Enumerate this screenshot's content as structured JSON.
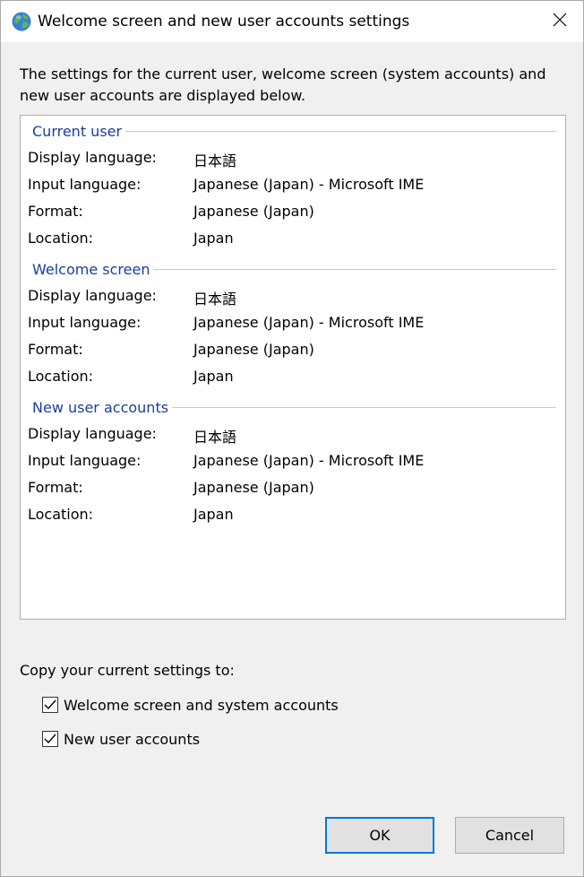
{
  "window": {
    "title": "Welcome screen and new user accounts settings",
    "icon": "globe-icon",
    "close_icon": "close-icon"
  },
  "intro_text": "The settings for the current user, welcome screen (system accounts) and new user accounts are displayed below.",
  "sections": [
    {
      "title": "Current user",
      "rows": [
        {
          "label": "Display language:",
          "value": "日本語"
        },
        {
          "label": "Input language:",
          "value": "Japanese (Japan) - Microsoft IME"
        },
        {
          "label": "Format:",
          "value": "Japanese (Japan)"
        },
        {
          "label": "Location:",
          "value": "Japan"
        }
      ]
    },
    {
      "title": "Welcome screen",
      "rows": [
        {
          "label": "Display language:",
          "value": "日本語"
        },
        {
          "label": "Input language:",
          "value": "Japanese (Japan) - Microsoft IME"
        },
        {
          "label": "Format:",
          "value": "Japanese (Japan)"
        },
        {
          "label": "Location:",
          "value": "Japan"
        }
      ]
    },
    {
      "title": "New user accounts",
      "rows": [
        {
          "label": "Display language:",
          "value": "日本語"
        },
        {
          "label": "Input language:",
          "value": "Japanese (Japan) - Microsoft IME"
        },
        {
          "label": "Format:",
          "value": "Japanese (Japan)"
        },
        {
          "label": "Location:",
          "value": "Japan"
        }
      ]
    }
  ],
  "copy": {
    "label": "Copy your current settings to:",
    "options": [
      {
        "label": "Welcome screen and system accounts",
        "checked": true
      },
      {
        "label": "New user accounts",
        "checked": true
      }
    ]
  },
  "buttons": {
    "ok": "OK",
    "cancel": "Cancel"
  },
  "colors": {
    "section_title": "#1a3e9c",
    "ok_border": "#0078d7"
  }
}
